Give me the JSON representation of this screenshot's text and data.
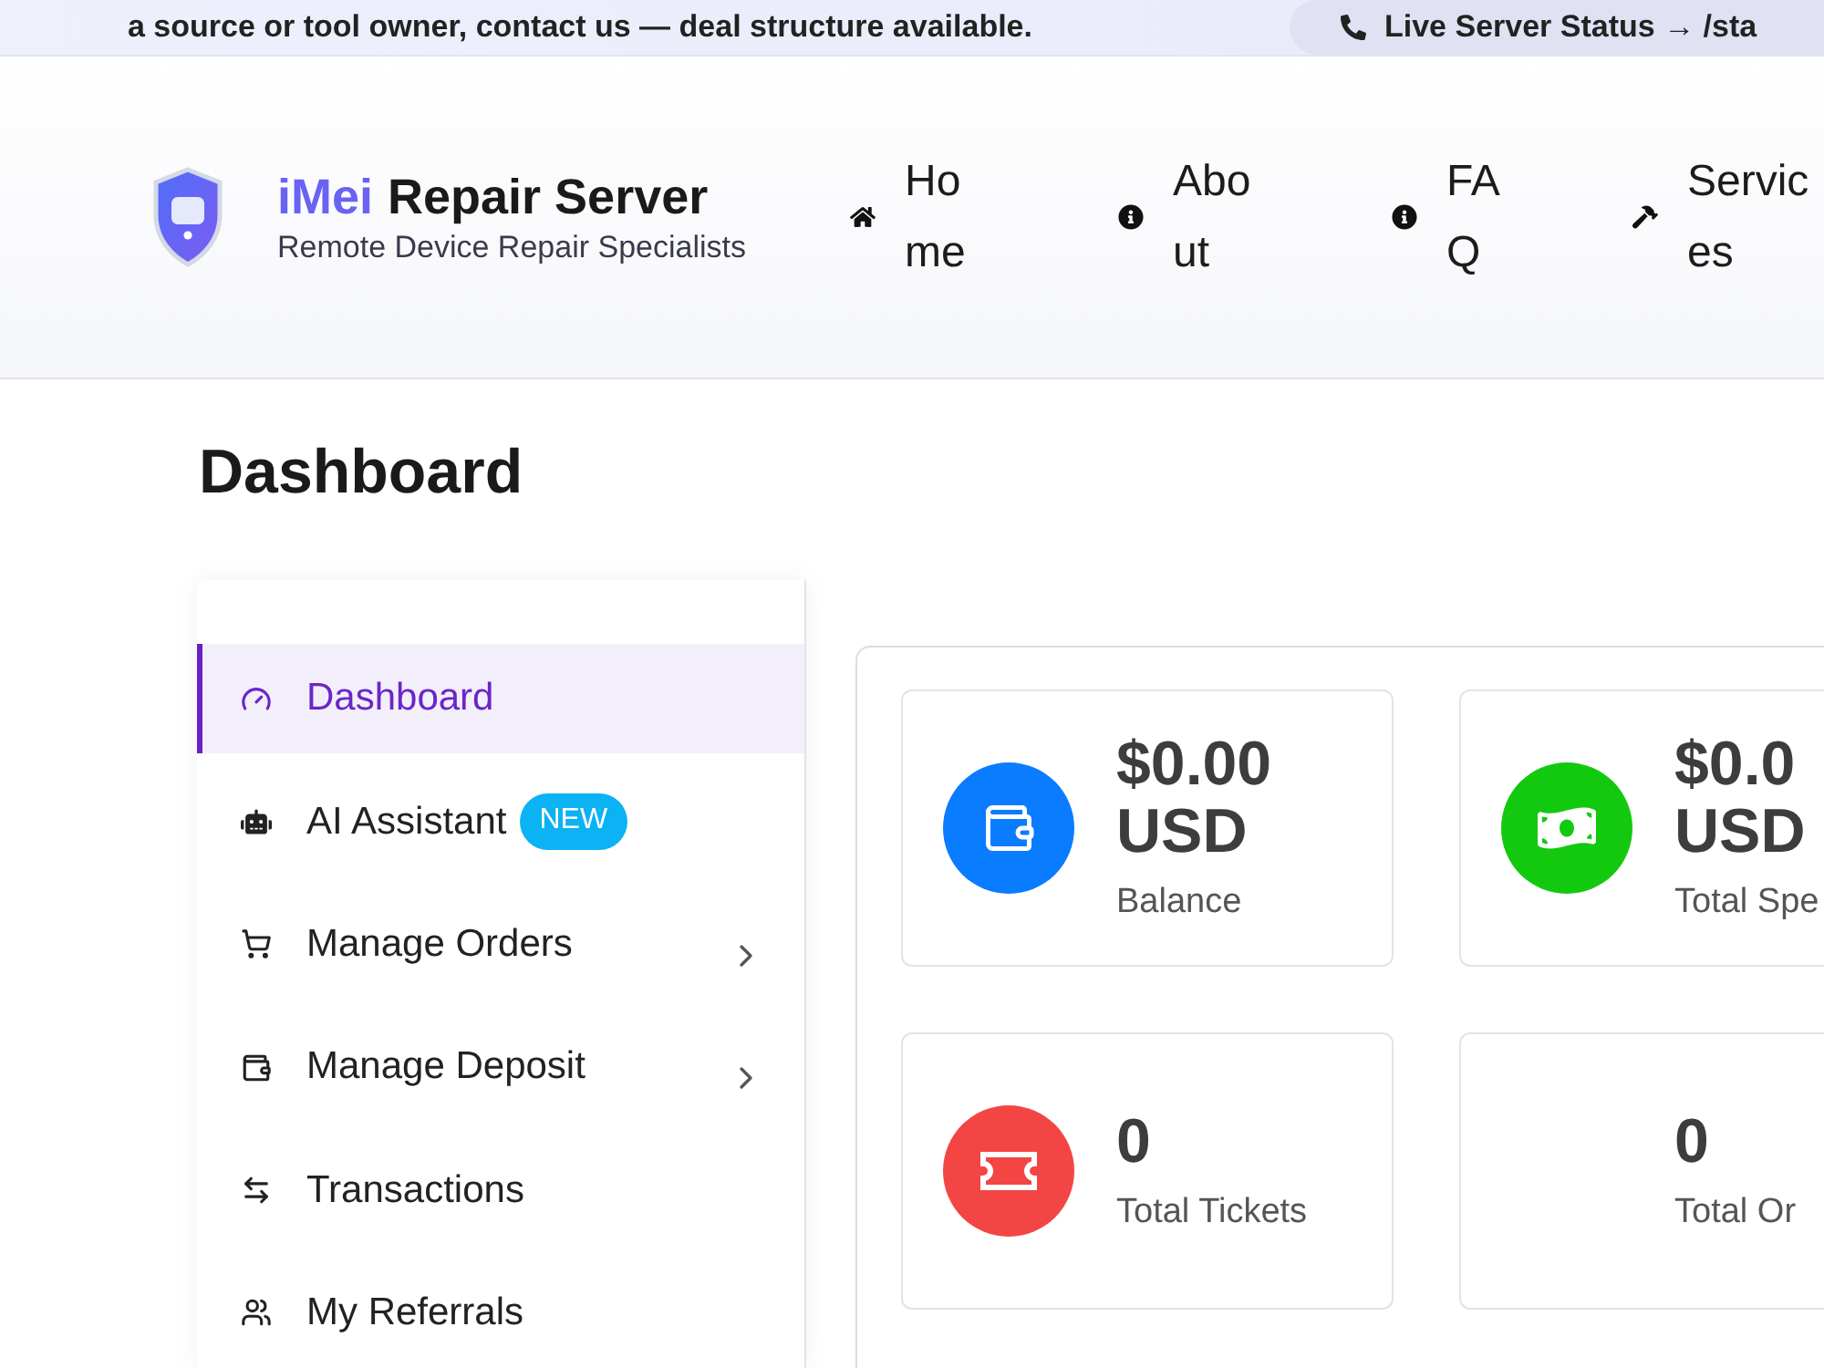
{
  "banner": {
    "text": "a source or tool owner, contact us — deal structure available.",
    "status_link": "Live Server Status → /sta"
  },
  "header": {
    "brand_prefix": "iMei",
    "brand_name": "Repair Server",
    "tagline": "Remote Device Repair Specialists",
    "nav": [
      {
        "label": "Home"
      },
      {
        "label": "About"
      },
      {
        "label": "FAQ"
      },
      {
        "label": "Services"
      }
    ]
  },
  "page_title": "Dashboard",
  "sidebar": {
    "items": [
      {
        "label": "Dashboard",
        "selected": true,
        "submenu": false
      },
      {
        "label": "AI Assistant",
        "badge": "NEW",
        "selected": false,
        "submenu": false
      },
      {
        "label": "Manage Orders",
        "selected": false,
        "submenu": true
      },
      {
        "label": "Manage Deposit",
        "selected": false,
        "submenu": true
      },
      {
        "label": "Transactions",
        "selected": false,
        "submenu": false
      },
      {
        "label": "My Referrals",
        "selected": false,
        "submenu": false
      }
    ]
  },
  "cards": [
    {
      "kind": "wallet",
      "color": "#0a7cff",
      "value": "$0.00 USD",
      "label": "Balance"
    },
    {
      "kind": "cash",
      "color": "#13c90f",
      "value": "$0.0 USD",
      "label": "Total Spe"
    },
    {
      "kind": "ticket",
      "color": "#f44545",
      "value": "0",
      "label": "Total Tickets"
    },
    {
      "kind": "plain",
      "value": "0",
      "label": "Total Or"
    }
  ]
}
